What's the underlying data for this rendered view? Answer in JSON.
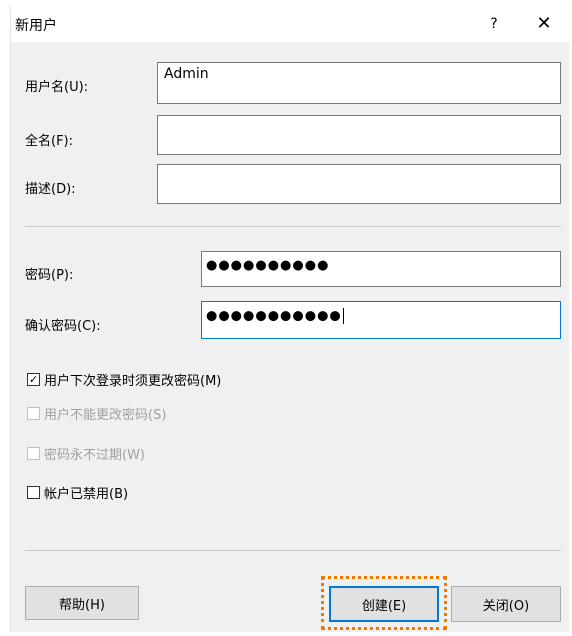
{
  "window": {
    "title": "新用户",
    "help_glyph": "?",
    "close_glyph": "✕"
  },
  "labels": {
    "username": "用户名(U):",
    "fullname": "全名(F):",
    "description": "描述(D):",
    "password": "密码(P):",
    "confirm": "确认密码(C):"
  },
  "fields": {
    "username_value": "Admin",
    "fullname_value": "",
    "description_value": "",
    "password_mask": "●●●●●●●●●●",
    "confirm_mask": "●●●●●●●●●●●"
  },
  "checkboxes": [
    {
      "label": "用户下次登录时须更改密码(M)",
      "checked": true,
      "enabled": true
    },
    {
      "label": "用户不能更改密码(S)",
      "checked": false,
      "enabled": false
    },
    {
      "label": "密码永不过期(W)",
      "checked": false,
      "enabled": false
    },
    {
      "label": "帐户已禁用(B)",
      "checked": false,
      "enabled": true
    }
  ],
  "buttons": {
    "help": "帮助(H)",
    "create": "创建(E)",
    "close": "关闭(O)"
  },
  "colors": {
    "focus_border": "#0078d7",
    "highlight": "#f07a00"
  }
}
